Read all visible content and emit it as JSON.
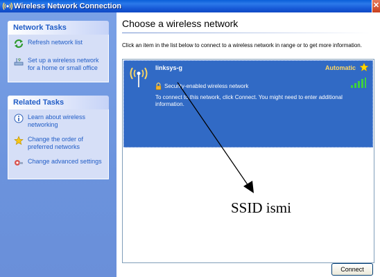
{
  "window": {
    "title": "Wireless Network Connection"
  },
  "left_pane": {
    "network_tasks": {
      "heading": "Network Tasks",
      "items": [
        {
          "label": "Refresh network list",
          "icon": "refresh-icon"
        },
        {
          "label": "Set up a wireless network for a home or small office",
          "icon": "setup-wireless-icon"
        }
      ]
    },
    "related_tasks": {
      "heading": "Related Tasks",
      "items": [
        {
          "label": "Learn about wireless networking",
          "icon": "info-icon"
        },
        {
          "label": "Change the order of preferred networks",
          "icon": "star-order-icon"
        },
        {
          "label": "Change advanced settings",
          "icon": "settings-icon"
        }
      ]
    }
  },
  "main": {
    "heading": "Choose a wireless network",
    "instructions": "Click an item in the list below to connect to a wireless network in range or to get more information.",
    "networks": [
      {
        "ssid": "linksys-g",
        "mode": "Automatic",
        "security": "Security-enabled wireless network",
        "description": "To connect to this network, click Connect. You might need to enter additional information."
      }
    ],
    "connect_label": "Connect"
  },
  "annotation": {
    "label": "SSID ismi"
  },
  "colors": {
    "selection": "#316ac5",
    "title_bar": "#0a5fd8",
    "left_pane": "#7aa1e6",
    "link": "#215dc6",
    "automatic": "#ffd862"
  }
}
